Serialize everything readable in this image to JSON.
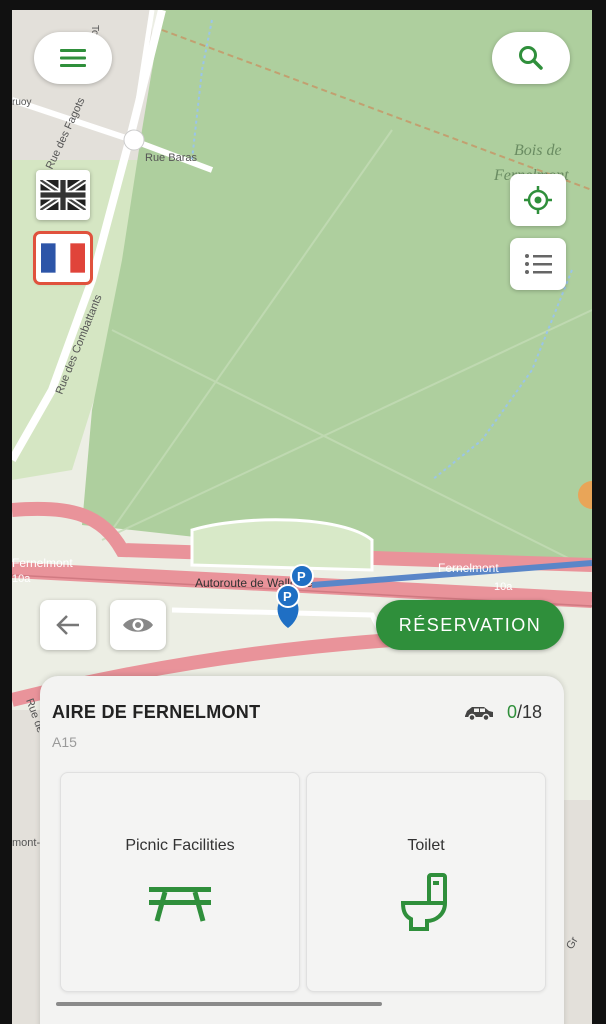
{
  "map": {
    "labels": {
      "rue_baras": "Rue Baras",
      "rue_des_fagots": "Rue des Fagots",
      "rue_des_combattants": "Rue des Combattants",
      "bois_line1": "Bois de",
      "bois_line2": "Fernelmont",
      "autoroute": "Autoroute de Wallonie",
      "fernelmont_left": "Fernelmont",
      "fernelmont_right": "Fernelmont",
      "exit_10a_left": "10a",
      "exit_10a_right": "10a",
      "rue_de": "Rue de",
      "mont_an": "mont-An",
      "gr": "Gr",
      "tou": "Tou",
      "ruoy": "ruoy"
    },
    "markers": [
      "parking-marker",
      "parking-marker"
    ]
  },
  "controls": {
    "menu_icon": "hamburger-icon",
    "search_icon": "search-icon",
    "locate_icon": "crosshair-icon",
    "list_icon": "list-icon",
    "back_icon": "arrow-left-icon",
    "eye_icon": "eye-icon",
    "languages": [
      "en",
      "fr"
    ],
    "active_language": "fr"
  },
  "reservation_label": "RÉSERVATION",
  "area": {
    "name": "AIRE DE FERNELMONT",
    "road": "A15",
    "capacity_used": "0",
    "capacity_total": "/18",
    "capacity_icon": "car-icon",
    "facilities": [
      {
        "label": "Picnic Facilities",
        "icon": "picnic-table-icon"
      },
      {
        "label": "Toilet",
        "icon": "toilet-icon"
      }
    ]
  },
  "colors": {
    "accent": "#2f8f3b",
    "forest": "#aecf9e",
    "motorway": "#e9939a",
    "route": "#5a86c8"
  }
}
